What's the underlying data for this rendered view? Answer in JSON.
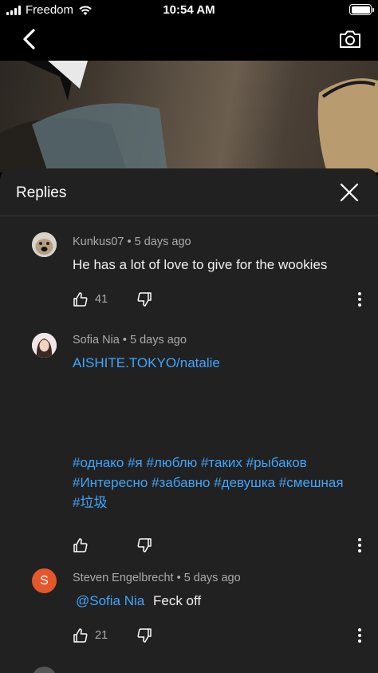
{
  "status_bar": {
    "carrier": "Freedom",
    "time": "10:54 AM"
  },
  "app_bar": {
    "back_icon": "chevron-left-icon",
    "camera_icon": "camera-icon"
  },
  "sheet": {
    "title": "Replies",
    "close_icon": "close-icon"
  },
  "comments": [
    {
      "author": "Kunkus07",
      "age": "5 days ago",
      "text": "He has a lot of love to give for the wookies",
      "likes": "41"
    },
    {
      "author": "Sofia Nia",
      "age": "5 days ago",
      "link": "AISHITE.TOKYO/natalie",
      "hashtag_lines": [
        "#однако #я #люблю #таких #рыбаков",
        "#Интересно #забавно #девушка #смешная",
        "#垃圾"
      ],
      "likes": ""
    },
    {
      "author": "Steven Engelbrecht",
      "age": "5 days ago",
      "avatar_letter": "S",
      "mention": "@Sofia Nia",
      "text": "Feck off",
      "likes": "21"
    }
  ],
  "colors": {
    "link": "#3ea6ff",
    "sheet_bg": "#212121",
    "avatar_s": "#e3572b"
  }
}
